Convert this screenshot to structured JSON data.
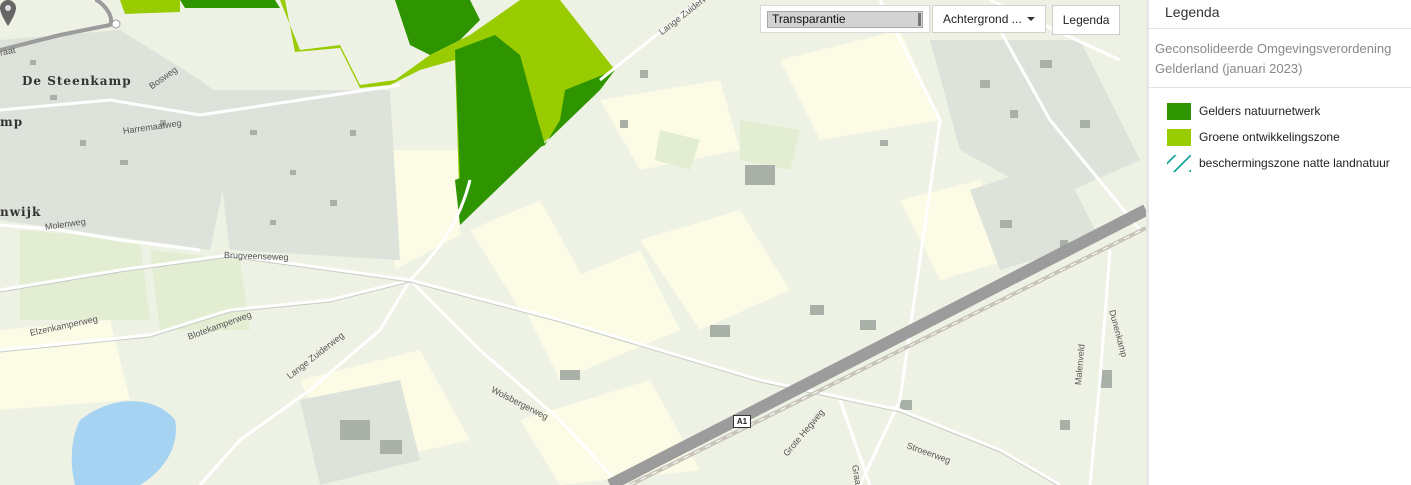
{
  "toolbar": {
    "transparency_label": "Transparantie",
    "background_label": "Achtergrond ...",
    "legend_button": "Legenda"
  },
  "map": {
    "place_labels": [
      "raat",
      "De Steenkamp",
      "mp",
      "nwijk",
      "Bosweg",
      "Harremaatweg",
      "Molenweg",
      "Brugveenseweg",
      "Elzenkamperweg",
      "Blotekamperweg",
      "Lange Zuiderweg",
      "Lange Zuiderweg",
      "Wolsbergerweg",
      "Grote Hegweg",
      "Graaf",
      "Stroeerweg",
      "Malenveld",
      "Dunenkamp"
    ],
    "road_shield": "A1",
    "colors": {
      "natuurnetwerk": "#2e9500",
      "ontwikkelingszone": "#99cc00",
      "natte_landnatuur": "#1aa89a",
      "water": "#a7d3f2"
    }
  },
  "legend": {
    "title": "Legenda",
    "subtitle": "Geconsolideerde Omgevingsverordening Gelderland (januari 2023)",
    "items": [
      {
        "label": "Gelders natuurnetwerk",
        "color": "#2e9500",
        "style": "fill"
      },
      {
        "label": "Groene ontwikkelingszone",
        "color": "#99cc00",
        "style": "fill"
      },
      {
        "label": "beschermingszone natte landnatuur",
        "color": "#1aa89a",
        "style": "hatch"
      }
    ]
  }
}
